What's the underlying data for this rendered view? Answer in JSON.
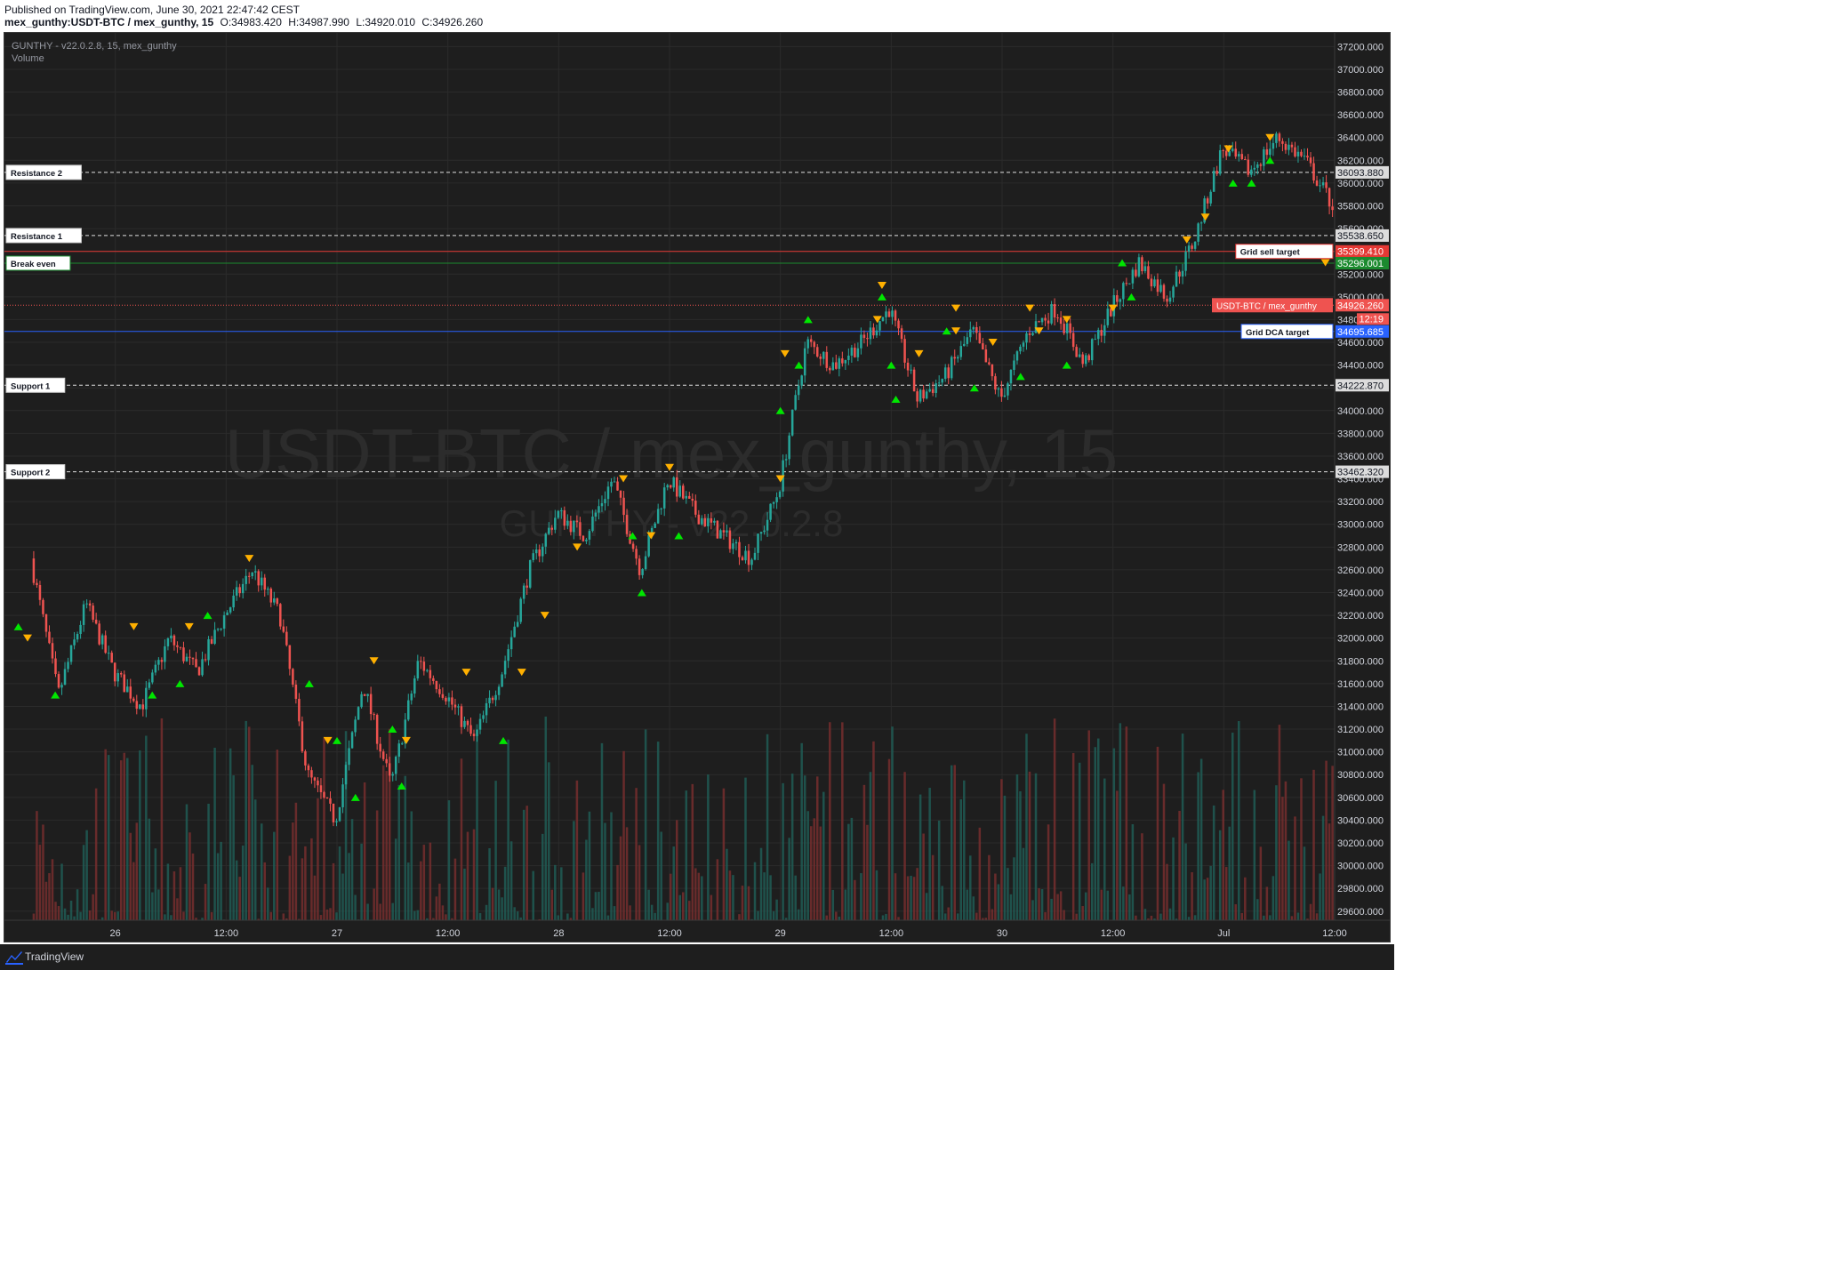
{
  "header": {
    "published": "Published on TradingView.com, June 30, 2021 22:47:42 CEST",
    "symbol_line": "mex_gunthy:USDT-BTC / mex_gunthy, 15",
    "ohlc": {
      "O": "34983.420",
      "H": "34987.990",
      "L": "34920.010",
      "C": "34926.260"
    }
  },
  "legend": {
    "indicator": "GUNTHY - v22.0.2.8, 15, mex_gunthy",
    "volume": "Volume"
  },
  "watermark": {
    "main": "USDT-BTC / mex_gunthy, 15",
    "sub": "GUNTHY - v22.0.2.8"
  },
  "footer": {
    "brand": "TradingView"
  },
  "colors": {
    "background": "#1e1e1e",
    "grid": "#2b2b2b",
    "up": "#26a69a",
    "down": "#ef5350",
    "buy_marker": "#00e600",
    "sell_marker": "#ffb000",
    "sell_target": "#e53935",
    "break_even": "#1b8a2e",
    "dca_target": "#2962ff"
  },
  "chart_data": {
    "type": "candlestick",
    "title": "",
    "xlabel": "",
    "ylabel": "",
    "ylim": [
      29520,
      37320
    ],
    "x_range": [
      "2021-06-25T12:00",
      "2021-07-01T12:00"
    ],
    "x_ticks": [
      "26",
      "12:00",
      "27",
      "12:00",
      "28",
      "12:00",
      "29",
      "12:00",
      "30",
      "12:00",
      "Jul",
      "12:00"
    ],
    "y_ticks": [
      29600,
      29800,
      30000,
      30200,
      30400,
      30600,
      30800,
      31000,
      31200,
      31400,
      31600,
      31800,
      32000,
      32200,
      32400,
      32600,
      32800,
      33000,
      33200,
      33400,
      33600,
      33800,
      34000,
      34200,
      34400,
      34600,
      34800,
      35000,
      35200,
      35400,
      35600,
      35800,
      36000,
      36200,
      36400,
      36600,
      36800,
      37000,
      37200
    ],
    "price_path": [
      [
        "2021-06-25T15:00",
        32700
      ],
      [
        "2021-06-25T18:00",
        31500
      ],
      [
        "2021-06-25T21:00",
        32300
      ],
      [
        "2021-06-26T00:00",
        31700
      ],
      [
        "2021-06-26T03:00",
        31400
      ],
      [
        "2021-06-26T06:00",
        32000
      ],
      [
        "2021-06-26T09:00",
        31700
      ],
      [
        "2021-06-26T12:00",
        32200
      ],
      [
        "2021-06-26T15:00",
        32600
      ],
      [
        "2021-06-26T18:00",
        32200
      ],
      [
        "2021-06-26T21:00",
        30800
      ],
      [
        "2021-06-27T00:00",
        30400
      ],
      [
        "2021-06-27T03:00",
        31600
      ],
      [
        "2021-06-27T06:00",
        30700
      ],
      [
        "2021-06-27T09:00",
        31800
      ],
      [
        "2021-06-27T12:00",
        31500
      ],
      [
        "2021-06-27T15:00",
        31100
      ],
      [
        "2021-06-27T18:00",
        31700
      ],
      [
        "2021-06-27T21:00",
        32600
      ],
      [
        "2021-06-28T00:00",
        33100
      ],
      [
        "2021-06-28T03:00",
        32900
      ],
      [
        "2021-06-28T06:00",
        33400
      ],
      [
        "2021-06-28T09:00",
        32600
      ],
      [
        "2021-06-28T12:00",
        33400
      ],
      [
        "2021-06-28T15:00",
        33100
      ],
      [
        "2021-06-28T18:00",
        32900
      ],
      [
        "2021-06-28T21:00",
        32700
      ],
      [
        "2021-06-29T00:00",
        33300
      ],
      [
        "2021-06-29T03:00",
        34600
      ],
      [
        "2021-06-29T06:00",
        34400
      ],
      [
        "2021-06-29T09:00",
        34600
      ],
      [
        "2021-06-29T12:00",
        34900
      ],
      [
        "2021-06-29T15:00",
        34100
      ],
      [
        "2021-06-29T18:00",
        34300
      ],
      [
        "2021-06-29T21:00",
        34700
      ],
      [
        "2021-06-30T00:00",
        34100
      ],
      [
        "2021-06-30T03:00",
        34700
      ],
      [
        "2021-06-30T06:00",
        34900
      ],
      [
        "2021-06-30T09:00",
        34400
      ],
      [
        "2021-06-30T12:00",
        34900
      ],
      [
        "2021-06-30T15:00",
        35300
      ],
      [
        "2021-06-30T18:00",
        35000
      ],
      [
        "2021-06-30T21:00",
        35500
      ],
      [
        "2021-07-01T00:00",
        36300
      ],
      [
        "2021-07-01T03:00",
        36100
      ],
      [
        "2021-07-01T06:00",
        36400
      ],
      [
        "2021-07-01T09:00",
        36200
      ],
      [
        "2021-07-01T12:00",
        35800
      ],
      [
        "2021-07-01T15:00",
        35900
      ],
      [
        "2021-07-01T18:00",
        35500
      ],
      [
        "2021-07-01T21:00",
        35000
      ],
      [
        "2021-07-02T00:00",
        34700
      ],
      [
        "2021-07-02T03:00",
        35200
      ],
      [
        "2021-07-02T06:00",
        34600
      ],
      [
        "2021-07-02T09:00",
        34800
      ],
      [
        "2021-07-02T12:00",
        34500
      ],
      [
        "2021-07-02T15:00",
        34300
      ],
      [
        "2021-07-02T18:00",
        34200
      ],
      [
        "2021-07-02T21:00",
        34700
      ],
      [
        "2021-07-02T22:45",
        34926
      ]
    ],
    "volume": {
      "min": 0,
      "max": 60,
      "bars": 520
    },
    "levels": [
      {
        "name": "Resistance 2",
        "value": 36093.88,
        "display": "36093.880",
        "style": "dashed",
        "color": "#e0e0e0",
        "label_side": "left"
      },
      {
        "name": "Resistance 1",
        "value": 35538.65,
        "display": "35538.650",
        "style": "dashed",
        "color": "#e0e0e0",
        "label_side": "left"
      },
      {
        "name": "Grid sell target",
        "value": 35399.41,
        "display": "35399.410",
        "style": "solid",
        "color": "#e53935",
        "label_side": "right"
      },
      {
        "name": "Break even",
        "value": 35296.001,
        "display": "35296.001",
        "style": "solid",
        "color": "#1b8a2e",
        "label_side": "left"
      },
      {
        "name": "Grid DCA target",
        "value": 34695.685,
        "display": "34695.685",
        "style": "solid",
        "color": "#2962ff",
        "label_side": "right"
      },
      {
        "name": "Support 1",
        "value": 34222.87,
        "display": "34222.870",
        "style": "dashed",
        "color": "#e0e0e0",
        "label_side": "left"
      },
      {
        "name": "Support 2",
        "value": 33462.32,
        "display": "33462.320",
        "style": "dashed",
        "color": "#e0e0e0",
        "label_side": "left"
      }
    ],
    "last_price": {
      "label": "USDT-BTC / mex_gunthy",
      "value": 34926.26,
      "display": "34926.260",
      "countdown": "12:19"
    },
    "markers": {
      "buy": [
        [
          "2021-06-25T13:30",
          32100
        ],
        [
          "2021-06-25T17:30",
          31500
        ],
        [
          "2021-06-26T04:00",
          31500
        ],
        [
          "2021-06-26T07:00",
          31600
        ],
        [
          "2021-06-26T10:00",
          32200
        ],
        [
          "2021-06-26T21:00",
          31600
        ],
        [
          "2021-06-27T00:00",
          31100
        ],
        [
          "2021-06-27T02:00",
          30600
        ],
        [
          "2021-06-27T06:00",
          31200
        ],
        [
          "2021-06-27T07:00",
          30700
        ],
        [
          "2021-06-27T18:00",
          31100
        ],
        [
          "2021-06-28T08:00",
          32900
        ],
        [
          "2021-06-28T09:00",
          32400
        ],
        [
          "2021-06-28T13:00",
          32900
        ],
        [
          "2021-06-29T00:00",
          34000
        ],
        [
          "2021-06-29T02:00",
          34400
        ],
        [
          "2021-06-29T03:00",
          34800
        ],
        [
          "2021-06-29T11:00",
          35000
        ],
        [
          "2021-06-29T12:00",
          34400
        ],
        [
          "2021-06-29T12:30",
          34100
        ],
        [
          "2021-06-29T18:00",
          34700
        ],
        [
          "2021-06-29T21:00",
          34200
        ],
        [
          "2021-06-30T02:00",
          34300
        ],
        [
          "2021-06-30T07:00",
          34400
        ],
        [
          "2021-06-30T13:00",
          35300
        ],
        [
          "2021-06-30T14:00",
          35000
        ],
        [
          "2021-07-01T01:00",
          36000
        ],
        [
          "2021-07-01T03:00",
          36000
        ],
        [
          "2021-07-01T05:00",
          36200
        ],
        [
          "2021-07-01T15:00",
          35800
        ],
        [
          "2021-07-01T19:00",
          35500
        ],
        [
          "2021-07-01T20:00",
          35200
        ],
        [
          "2021-07-01T23:00",
          34700
        ],
        [
          "2021-07-02T02:00",
          34900
        ],
        [
          "2021-07-02T04:00",
          34600
        ],
        [
          "2021-07-02T12:00",
          34300
        ]
      ],
      "sell": [
        [
          "2021-06-25T14:30",
          32000
        ],
        [
          "2021-06-26T02:00",
          32100
        ],
        [
          "2021-06-26T08:00",
          32100
        ],
        [
          "2021-06-26T14:30",
          32700
        ],
        [
          "2021-06-26T23:00",
          31100
        ],
        [
          "2021-06-27T04:00",
          31800
        ],
        [
          "2021-06-27T07:30",
          31100
        ],
        [
          "2021-06-27T14:00",
          31700
        ],
        [
          "2021-06-27T20:00",
          31700
        ],
        [
          "2021-06-27T22:30",
          32200
        ],
        [
          "2021-06-28T02:00",
          32800
        ],
        [
          "2021-06-28T07:00",
          33400
        ],
        [
          "2021-06-28T10:00",
          32900
        ],
        [
          "2021-06-28T12:00",
          33500
        ],
        [
          "2021-06-29T00:00",
          33400
        ],
        [
          "2021-06-29T00:30",
          34500
        ],
        [
          "2021-06-29T11:00",
          35100
        ],
        [
          "2021-06-29T10:30",
          34800
        ],
        [
          "2021-06-29T15:00",
          34500
        ],
        [
          "2021-06-29T19:00",
          34900
        ],
        [
          "2021-06-29T19:00",
          34700
        ],
        [
          "2021-06-29T23:00",
          34600
        ],
        [
          "2021-06-30T03:00",
          34900
        ],
        [
          "2021-06-30T04:00",
          34700
        ],
        [
          "2021-06-30T07:00",
          34800
        ],
        [
          "2021-06-30T12:00",
          34900
        ],
        [
          "2021-06-30T20:00",
          35500
        ],
        [
          "2021-06-30T22:00",
          35700
        ],
        [
          "2021-07-01T00:30",
          36300
        ],
        [
          "2021-07-01T05:00",
          36400
        ],
        [
          "2021-07-01T11:00",
          35300
        ],
        [
          "2021-07-01T23:00",
          35200
        ],
        [
          "2021-07-02T14:00",
          34600
        ],
        [
          "2021-07-02T22:30",
          35000
        ]
      ]
    }
  }
}
